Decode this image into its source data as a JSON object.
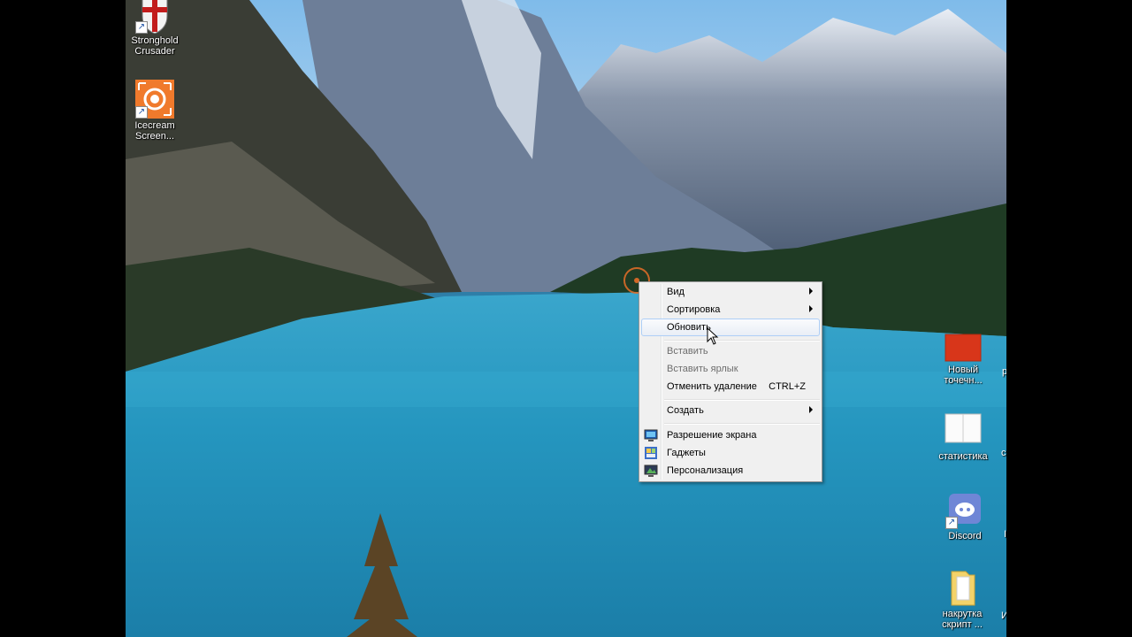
{
  "desktop_icons": [
    {
      "id": "stronghold",
      "label_line1": "Stronghold",
      "label_line2": "Crusader",
      "icon": "shield-icon"
    },
    {
      "id": "icecream",
      "label_line1": "Icecream",
      "label_line2": "Screen...",
      "icon": "camera-icon"
    },
    {
      "id": "new-bitmap",
      "label_line1": "Новый",
      "label_line2": "точечн...",
      "icon": "image-icon"
    },
    {
      "id": "stats",
      "label_line1": "статистика",
      "label_line2": "",
      "icon": "book-icon"
    },
    {
      "id": "discord",
      "label_line1": "Discord",
      "label_line2": "",
      "icon": "discord-icon"
    },
    {
      "id": "nakrutka",
      "label_line1": "накрутка",
      "label_line2": "скрипт ...",
      "icon": "folder-icon"
    }
  ],
  "edge_fragments": [
    "р",
    "с",
    "I",
    "И"
  ],
  "context_menu": {
    "items": [
      {
        "label": "Вид",
        "submenu": true
      },
      {
        "label": "Сортировка",
        "submenu": true
      },
      {
        "label": "Обновить",
        "hover": true
      },
      {
        "label": "Вставить",
        "disabled": true
      },
      {
        "label": "Вставить ярлык",
        "disabled": true
      },
      {
        "label": "Отменить удаление",
        "shortcut": "CTRL+Z"
      },
      {
        "label": "Создать",
        "submenu": true
      },
      {
        "label": "Разрешение экрана",
        "icon": "monitor-icon"
      },
      {
        "label": "Гаджеты",
        "icon": "gadgets-icon"
      },
      {
        "label": "Персонализация",
        "icon": "personalize-icon"
      }
    ]
  },
  "colors": {
    "accent": "#aecff7",
    "lake": "#2596bf",
    "forest": "#1f3b24",
    "click_ring": "#e66e28"
  }
}
